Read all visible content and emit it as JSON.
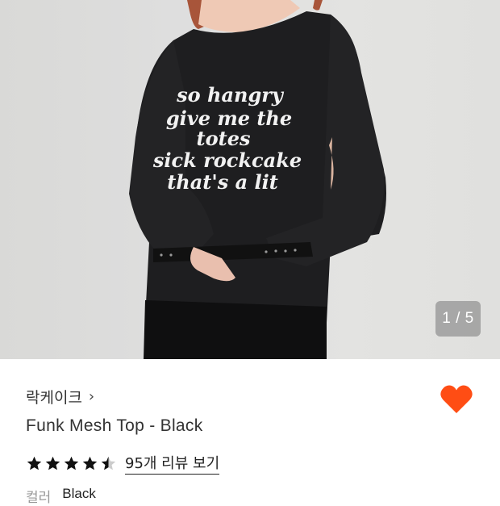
{
  "product": {
    "image_counter": "1 / 5",
    "shirt_print": [
      "so hangry",
      "give me the",
      "totes",
      "sick rockcake",
      "that's a lit"
    ],
    "brand": "락케이크",
    "brand_chevron": "›",
    "title": "Funk Mesh Top - Black",
    "rating": 4.5,
    "review_link": "95개 리뷰 보기",
    "option_label": "컬러",
    "option_value": "Black",
    "wishlist_color": "#ff4d14",
    "star_color": "#111111"
  }
}
